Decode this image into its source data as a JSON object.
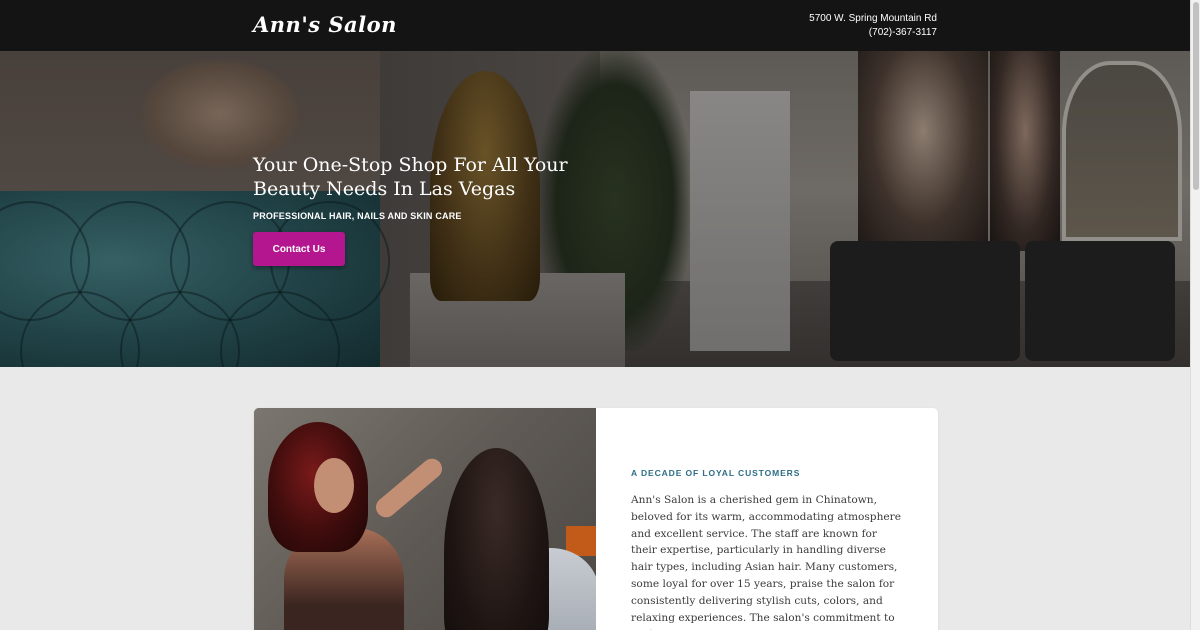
{
  "header": {
    "logo": "Ann's Salon",
    "address": "5700 W. Spring Mountain Rd",
    "phone": "(702)-367-3117"
  },
  "hero": {
    "title": "Your One-Stop Shop For All Your Beauty Needs In Las Vegas",
    "subtitle": "PROFESSIONAL HAIR, NAILS AND SKIN CARE",
    "button_label": "Contact Us"
  },
  "about": {
    "eyebrow": "A DECADE OF LOYAL CUSTOMERS",
    "body": "Ann's Salon is a cherished gem in Chinatown, beloved for its warm, accommodating atmosphere and excellent service. The staff are known for their expertise, particularly in handling diverse hair types, including Asian hair. Many customers, some loyal for over 15 years, praise the salon for consistently delivering stylish cuts, colors, and relaxing experiences. The salon's commitment to customer"
  },
  "colors": {
    "header_bg": "#141414",
    "accent_button": "#b3168f",
    "eyebrow_text": "#2d6e86",
    "page_bg": "#e9e9e9"
  }
}
